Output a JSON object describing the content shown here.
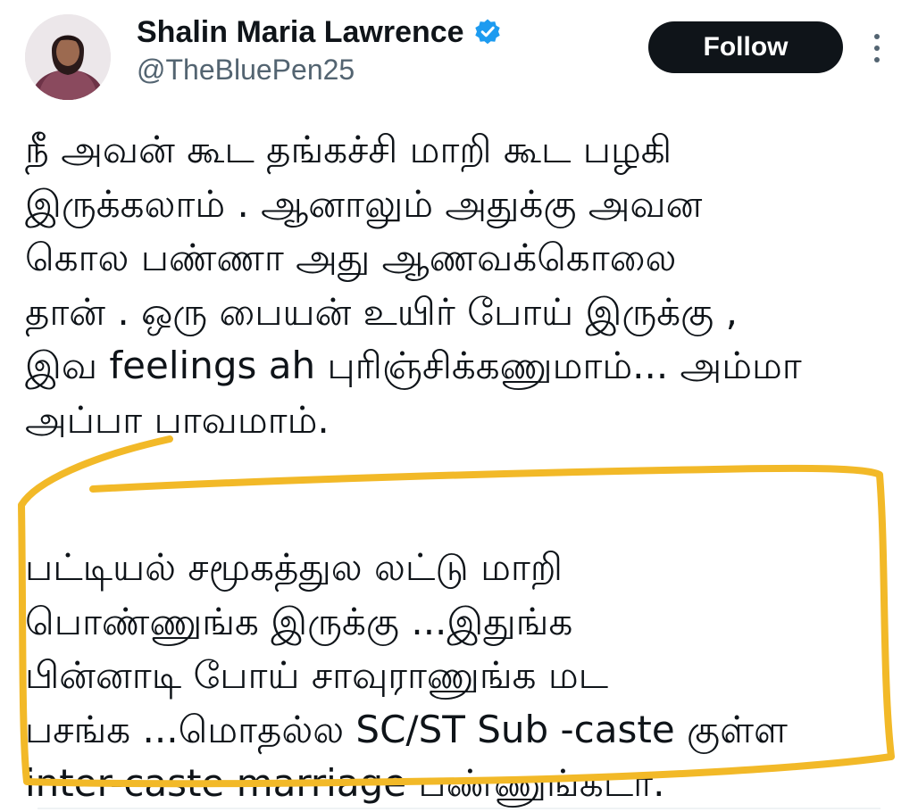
{
  "user": {
    "display_name": "Shalin Maria Lawrence",
    "handle": "@TheBluePen25",
    "verified": true
  },
  "actions": {
    "follow_label": "Follow",
    "more_icon": "more-vertical-icon"
  },
  "tweet": {
    "paragraph1": [
      "நீ அவன் கூட தங்கச்சி மாறி கூட பழகி",
      "இருக்கலாம் . ஆனாலும் அதுக்கு அவன",
      "கொல பண்ணா அது ஆணவக்கொலை",
      "தான் . ஒரு பையன் உயிர் போய் இருக்கு ,",
      "இவ feelings ah புரிஞ்சிக்கணுமாம்... அம்மா",
      "அப்பா பாவமாம்."
    ],
    "paragraph2": [
      "பட்டியல் சமூகத்துல லட்டு மாறி",
      "பொண்ணுங்க இருக்கு ...இதுங்க",
      "பின்னாடி போய் சாவுராணுங்க மட",
      "பசங்க ...மொதல்ல SC/ST Sub -caste குள்ள",
      "inter-caste marriage பண்ணுங்கடா."
    ]
  },
  "colors": {
    "text": "#0f1419",
    "secondary_text": "#536471",
    "verified_badge": "#1d9bf0",
    "follow_bg": "#0f1419",
    "highlight_marker": "#f2b928"
  }
}
